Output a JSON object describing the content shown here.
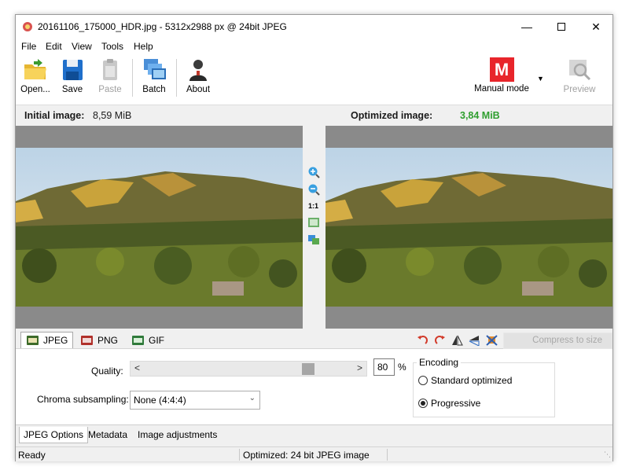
{
  "window": {
    "title": "20161106_175000_HDR.jpg - 5312x2988 px @ 24bit JPEG"
  },
  "menu": [
    "File",
    "Edit",
    "View",
    "Tools",
    "Help"
  ],
  "toolbar": {
    "open": "Open...",
    "save": "Save",
    "paste": "Paste",
    "batch": "Batch",
    "about": "About",
    "mode": "Manual mode",
    "mode_letter": "M",
    "preview": "Preview"
  },
  "info": {
    "initial_label": "Initial image:",
    "initial_size": "8,59 MiB",
    "optimized_label": "Optimized image:",
    "optimized_size": "3,84 MiB"
  },
  "zoom": {
    "one_to_one": "1:1"
  },
  "formats": {
    "jpeg": "JPEG",
    "png": "PNG",
    "gif": "GIF"
  },
  "compress_button": "Compress to size",
  "options": {
    "quality_label": "Quality:",
    "quality_value": "80",
    "quality_unit": "%",
    "quality_fraction": 0.8,
    "chroma_label": "Chroma subsampling:",
    "chroma_value": "None (4:4:4)",
    "encoding_title": "Encoding",
    "encoding_standard": "Standard optimized",
    "encoding_progressive": "Progressive"
  },
  "bottom_tabs": [
    "JPEG Options",
    "Metadata",
    "Image adjustments"
  ],
  "status": {
    "left": "Ready",
    "middle": "Optimized: 24 bit JPEG image"
  },
  "colors": {
    "optimized_size": "#2f9e2f",
    "manual_mode": "#e8252b"
  }
}
